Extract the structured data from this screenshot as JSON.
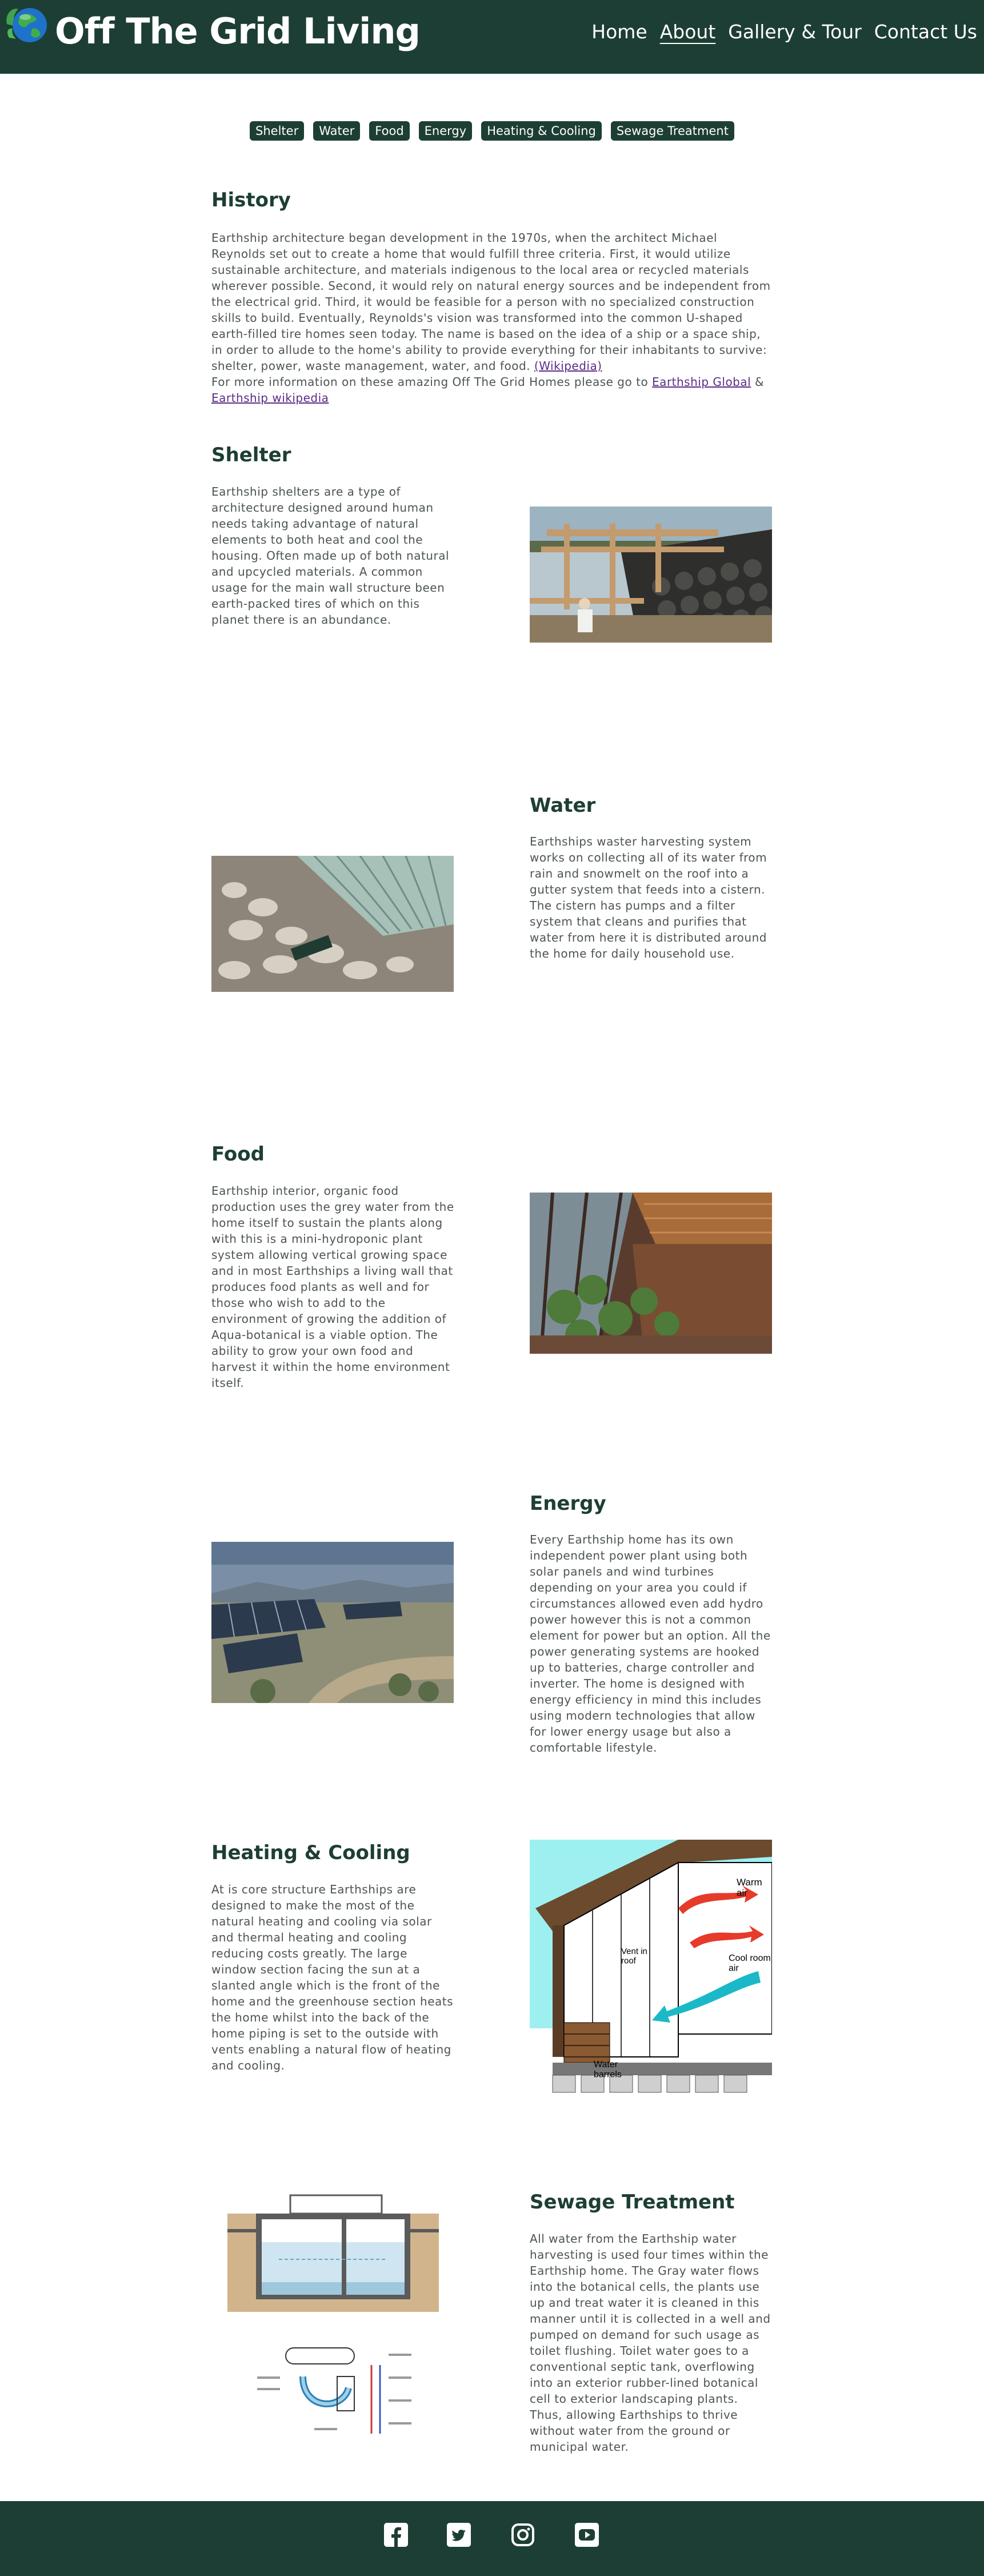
{
  "site": {
    "title": "Off The Grid Living"
  },
  "nav": {
    "items": [
      "Home",
      "About",
      "Gallery & Tour",
      "Contact Us"
    ],
    "active": "About"
  },
  "tabs": [
    "Shelter",
    "Water",
    "Food",
    "Energy",
    "Heating & Cooling",
    "Sewage Treatment"
  ],
  "history": {
    "heading": "History",
    "body": "Earthship architecture began development in the 1970s, when the architect Michael Reynolds set out to create a home that would fulfill three criteria. First, it would utilize sustainable architecture, and materials indigenous to the local area or recycled materials wherever possible. Second, it would rely on natural energy sources and be independent from the electrical grid. Third, it would be feasible for a person with no specialized construction skills to build. Eventually, Reynolds's vision was transformed into the common U-shaped earth-filled tire homes seen today. The name is based on the idea of a ship or a space ship, in order to allude to the home's ability to provide everything for their inhabitants to survive: shelter, power, waste management, water, and food.",
    "wiki_link": "(Wikipedia)",
    "more_prefix": "For more information on these amazing Off The Grid Homes please go to",
    "link_global": "Earthship Global",
    "amp": "&",
    "link_wiki": "Earthship wikipedia"
  },
  "shelter": {
    "heading": "Shelter",
    "body": "Earthship shelters are a type of architecture designed around human needs taking advantage of natural elements to both heat and cool the housing. Often made up of both natural and upcycled materials. A common usage for the main wall structure been earth-packed tires of which on this planet there is an abundance."
  },
  "water": {
    "heading": "Water",
    "body": "Earthships waster harvesting system works on collecting all of its water from rain and snowmelt on the roof into a gutter system that feeds into a cistern. The cistern has pumps and a filter system that cleans and purifies that water from here it is distributed around the home for daily household use."
  },
  "food": {
    "heading": "Food",
    "body": "Earthship interior, organic food production uses the grey water from the home itself to sustain the plants along with this is a mini-hydroponic plant system allowing vertical growing space and in most Earthships a living wall that produces food plants as well and for those who wish to add to the environment of growing the addition of Aqua-botanical is a viable option. The ability to grow your own food and harvest it within the home environment itself."
  },
  "energy": {
    "heading": "Energy",
    "body": "Every Earthship home has its own independent power plant using both solar panels and wind turbines depending on your area you could if circumstances allowed even add hydro power however this is not a common element for power but an option. All the power generating systems are hooked up to batteries, charge controller and inverter. The home is designed with energy efficiency in mind this includes using modern technologies that allow for lower energy usage but also a comfortable lifestyle."
  },
  "heating": {
    "heading": "Heating & Cooling",
    "body": "At is core structure Earthships are designed to make the most of the natural heating and cooling via solar and thermal heating and cooling reducing costs greatly. The large window section facing the sun at a slanted angle which is the front of the home and the greenhouse section heats the home whilst into the back of the home piping is set to the outside with vents enabling a natural flow of heating and cooling.",
    "diagram_labels": {
      "warm": "Warm air",
      "vent": "Vent in roof",
      "cool": "Cool room air",
      "barrels": "Water barrels"
    }
  },
  "sewage": {
    "heading": "Sewage Treatment",
    "body": "All water from the Earthship water harvesting is used four times within the Earthship home. The Gray water flows into the botanical cells, the plants use up and treat water it is cleaned in this manner until it is collected in a well and pumped on demand for such usage as toilet flushing. Toilet water goes to a conventional septic tank, overflowing into an exterior rubber-lined botanical cell to exterior landscaping plants. Thus, allowing Earthships to thrive without water from the ground or municipal water."
  },
  "footer": {
    "icons": [
      "facebook-icon",
      "twitter-icon",
      "instagram-icon",
      "youtube-icon"
    ]
  },
  "colors": {
    "brand": "#1d3e34",
    "link": "#5b2d86",
    "text": "#4d5454"
  }
}
